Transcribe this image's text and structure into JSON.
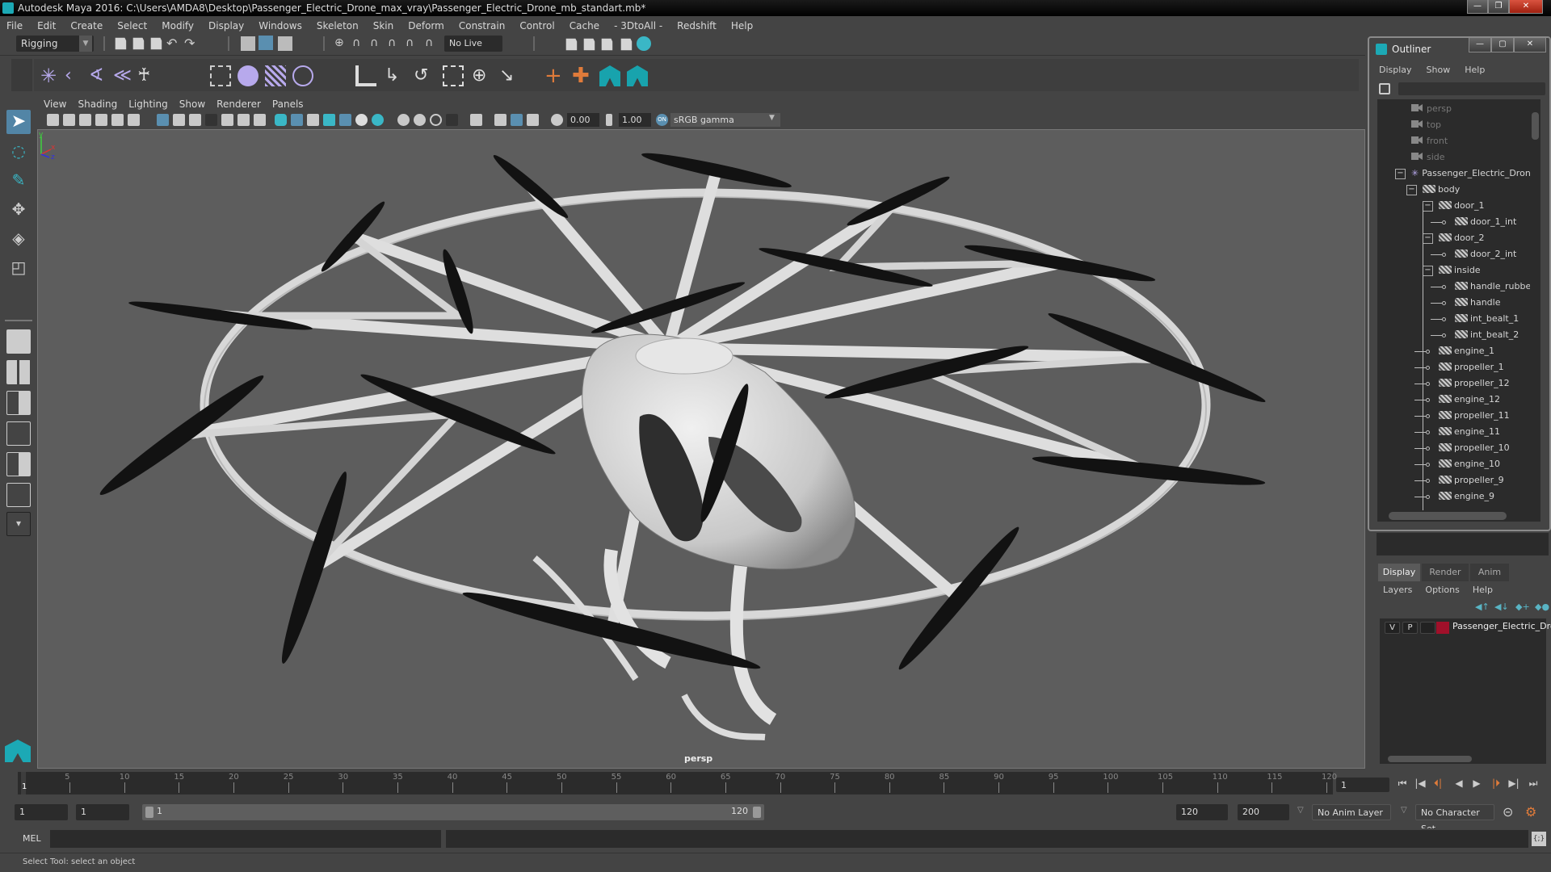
{
  "window": {
    "title": "Autodesk Maya 2016: C:\\Users\\AMDA8\\Desktop\\Passenger_Electric_Drone_max_vray\\Passenger_Electric_Drone_mb_standart.mb*",
    "minimize": "—",
    "restore": "❐",
    "close": "✕"
  },
  "menubar": [
    "File",
    "Edit",
    "Create",
    "Select",
    "Modify",
    "Display",
    "Windows",
    "Skeleton",
    "Skin",
    "Deform",
    "Constrain",
    "Control",
    "Cache",
    "- 3DtoAll -",
    "Redshift",
    "Help"
  ],
  "statusline": {
    "mode": "Rigging",
    "live_surface": "No Live Surface"
  },
  "shelf": {
    "icons": [
      "joint-tool-icon",
      "ik-handle-icon",
      "ik-spline-icon",
      "insert-joint-icon",
      "humanik-icon",
      "skin-bind-icon",
      "paint-weights-icon",
      "lattice-icon",
      "cluster-icon",
      "parent-constraint-icon",
      "point-constraint-icon",
      "orient-constraint-icon",
      "scale-constraint-icon",
      "aim-constraint-icon",
      "pole-vector-icon",
      "locator-icon",
      "locator-constraint-icon",
      "maya-logo-icon",
      "maya-logo-icon"
    ]
  },
  "viewport": {
    "menu": [
      "View",
      "Shading",
      "Lighting",
      "Show",
      "Renderer",
      "Panels"
    ],
    "near_value": "0.00",
    "exposure_value": "1.00",
    "gamma_toggle": "ON",
    "color_space": "sRGB gamma",
    "camera_label": "persp",
    "axis": {
      "x": "x",
      "y": "y",
      "z": "z"
    }
  },
  "outliner": {
    "title": "Outliner",
    "menu": [
      "Display",
      "Show",
      "Help"
    ],
    "items": [
      {
        "name": "persp",
        "type": "camera",
        "depth": 0
      },
      {
        "name": "top",
        "type": "camera",
        "depth": 0
      },
      {
        "name": "front",
        "type": "camera",
        "depth": 0
      },
      {
        "name": "side",
        "type": "camera",
        "depth": 0
      },
      {
        "name": "Passenger_Electric_Drone_mb",
        "type": "root",
        "depth": 0,
        "expanded": true
      },
      {
        "name": "body",
        "type": "mesh",
        "depth": 1,
        "expanded": true
      },
      {
        "name": "door_1",
        "type": "mesh",
        "depth": 2,
        "expanded": true
      },
      {
        "name": "door_1_int",
        "type": "mesh",
        "depth": 3
      },
      {
        "name": "door_2",
        "type": "mesh",
        "depth": 2,
        "expanded": true
      },
      {
        "name": "door_2_int",
        "type": "mesh",
        "depth": 3
      },
      {
        "name": "inside",
        "type": "mesh",
        "depth": 2,
        "expanded": true
      },
      {
        "name": "handle_rubber",
        "type": "mesh",
        "depth": 3
      },
      {
        "name": "handle",
        "type": "mesh",
        "depth": 3
      },
      {
        "name": "int_bealt_1",
        "type": "mesh",
        "depth": 3
      },
      {
        "name": "int_bealt_2",
        "type": "mesh",
        "depth": 3
      },
      {
        "name": "engine_1",
        "type": "mesh",
        "depth": 2
      },
      {
        "name": "propeller_1",
        "type": "mesh",
        "depth": 2
      },
      {
        "name": "propeller_12",
        "type": "mesh",
        "depth": 2
      },
      {
        "name": "engine_12",
        "type": "mesh",
        "depth": 2
      },
      {
        "name": "propeller_11",
        "type": "mesh",
        "depth": 2
      },
      {
        "name": "engine_11",
        "type": "mesh",
        "depth": 2
      },
      {
        "name": "propeller_10",
        "type": "mesh",
        "depth": 2
      },
      {
        "name": "engine_10",
        "type": "mesh",
        "depth": 2
      },
      {
        "name": "propeller_9",
        "type": "mesh",
        "depth": 2
      },
      {
        "name": "engine_9",
        "type": "mesh",
        "depth": 2
      }
    ]
  },
  "layers": {
    "tabs": [
      "Display",
      "Render",
      "Anim"
    ],
    "active_tab": "Display",
    "menu": [
      "Layers",
      "Options",
      "Help"
    ],
    "rows": [
      {
        "v": "V",
        "p": "P",
        "color": "#a0102a",
        "name": "Passenger_Electric_Drone"
      }
    ]
  },
  "timeline": {
    "ticks": [
      5,
      10,
      15,
      20,
      25,
      30,
      35,
      40,
      45,
      50,
      55,
      60,
      65,
      70,
      75,
      80,
      85,
      90,
      95,
      100,
      105,
      110,
      115,
      120
    ],
    "min": 1,
    "max": 120,
    "current_frame": "1",
    "current_frame_field": "1"
  },
  "range": {
    "start_field": "1",
    "anim_start_field": "1",
    "slider_start": "1",
    "slider_end": "120",
    "end_field": "120",
    "anim_end_field": "200",
    "anim_layer": "No Anim Layer",
    "character_set": "No Character Set"
  },
  "playback": [
    "⏮",
    "|◀",
    "⏴|",
    "◀",
    "▶",
    "|⏵",
    "▶|",
    "⏭"
  ],
  "command_line": {
    "label": "MEL",
    "value": ""
  },
  "status": {
    "help_line": "Select Tool: select an object"
  }
}
